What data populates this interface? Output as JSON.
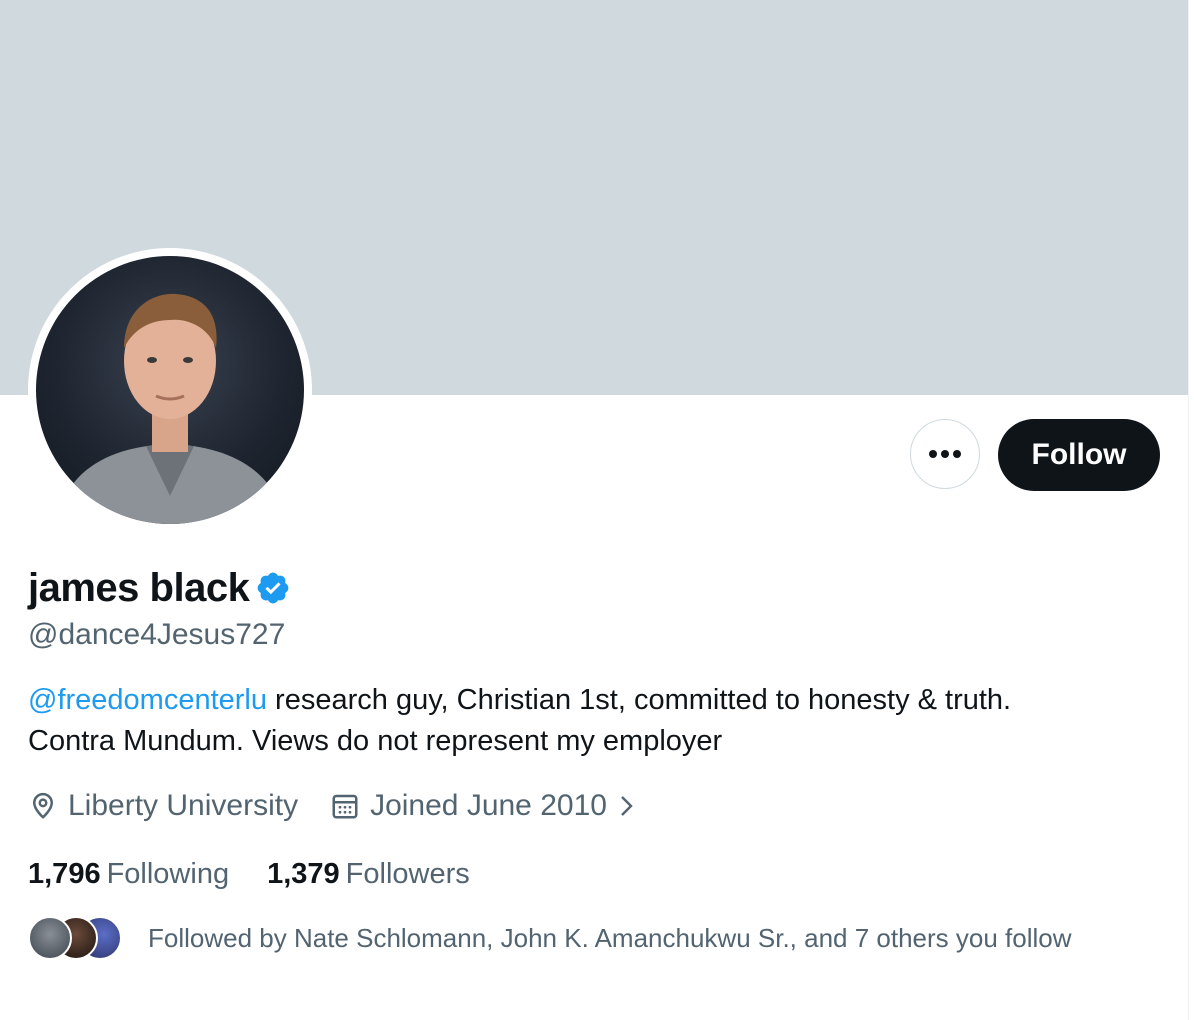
{
  "profile": {
    "display_name": "james black",
    "handle": "@dance4Jesus727",
    "bio_mention": "@freedomcenterlu",
    "bio_line1_rest": " research guy, Christian 1st, committed to honesty & truth.",
    "bio_line2": "Contra Mundum. Views do not represent my employer",
    "location": "Liberty University",
    "joined": "Joined June 2010",
    "verified_icon": "verified-badge-icon",
    "accent_color": "#1d9bf0"
  },
  "actions": {
    "more_icon": "more-icon",
    "follow_label": "Follow"
  },
  "stats": {
    "following_count": "1,796",
    "following_label": "Following",
    "followers_count": "1,379",
    "followers_label": "Followers"
  },
  "followed_by": {
    "text": "Followed by Nate Schlomann, John K. Amanchukwu Sr., and 7 others you follow"
  }
}
